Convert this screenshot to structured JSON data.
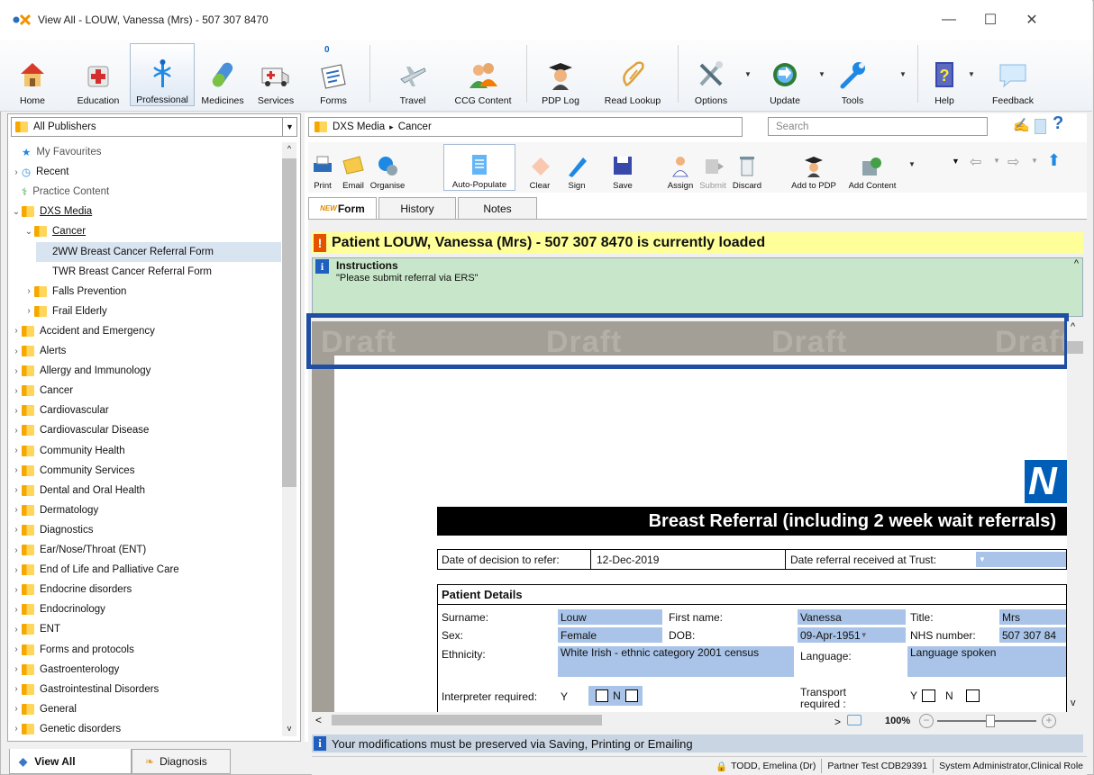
{
  "window": {
    "title": "View All  -  LOUW, Vanessa (Mrs) - 507 307 8470",
    "minimize": "—",
    "maximize": "☐",
    "close": "✕"
  },
  "ribbon": [
    {
      "label": "Home",
      "icon": "home-icon"
    },
    {
      "label": "Education",
      "icon": "education-icon"
    },
    {
      "label": "Professional",
      "icon": "professional-icon",
      "selected": true
    },
    {
      "label": "Medicines",
      "icon": "medicines-icon"
    },
    {
      "label": "Services",
      "icon": "ambulance-icon"
    },
    {
      "label": "Forms",
      "icon": "forms-icon",
      "badge": "0"
    },
    {
      "label": "Travel",
      "icon": "plane-icon"
    },
    {
      "label": "CCG Content",
      "icon": "ccg-content-icon"
    },
    {
      "label": "PDP Log",
      "icon": "graduate-icon"
    },
    {
      "label": "Read Lookup",
      "icon": "read-lookup-icon"
    },
    {
      "label": "Options",
      "icon": "options-icon"
    },
    {
      "label": "Update",
      "icon": "update-icon"
    },
    {
      "label": "Tools",
      "icon": "wrench-icon"
    },
    {
      "label": "Help",
      "icon": "help-icon"
    },
    {
      "label": "Feedback",
      "icon": "feedback-icon"
    }
  ],
  "publisher": "All Publishers",
  "tree": [
    {
      "label": "My Favourites",
      "indent": 0,
      "type": "fav"
    },
    {
      "label": "Recent",
      "indent": 0,
      "type": "recent",
      "arrow": ">"
    },
    {
      "label": "Practice Content",
      "indent": 0,
      "type": "practice"
    },
    {
      "label": "DXS Media",
      "indent": 0,
      "type": "dxs",
      "arrow": "v",
      "underline": true
    },
    {
      "label": "Cancer",
      "indent": 1,
      "type": "folder",
      "arrow": "v",
      "underline": true
    },
    {
      "label": "2WW Breast Cancer Referral Form",
      "indent": 2,
      "type": "item",
      "selected": true
    },
    {
      "label": "TWR Breast Cancer Referral Form",
      "indent": 2,
      "type": "item"
    },
    {
      "label": "Falls Prevention",
      "indent": 1,
      "type": "folder",
      "arrow": ">"
    },
    {
      "label": "Frail Elderly",
      "indent": 1,
      "type": "folder",
      "arrow": ">"
    },
    {
      "label": "Accident and Emergency",
      "indent": 0,
      "type": "folder",
      "arrow": ">"
    },
    {
      "label": "Alerts",
      "indent": 0,
      "type": "folder",
      "arrow": ">"
    },
    {
      "label": "Allergy and Immunology",
      "indent": 0,
      "type": "folder",
      "arrow": ">"
    },
    {
      "label": "Cancer",
      "indent": 0,
      "type": "folder",
      "arrow": ">"
    },
    {
      "label": "Cardiovascular",
      "indent": 0,
      "type": "folder",
      "arrow": ">"
    },
    {
      "label": "Cardiovascular Disease",
      "indent": 0,
      "type": "folder",
      "arrow": ">"
    },
    {
      "label": "Community Health",
      "indent": 0,
      "type": "folder",
      "arrow": ">"
    },
    {
      "label": "Community Services",
      "indent": 0,
      "type": "folder",
      "arrow": ">"
    },
    {
      "label": "Dental and Oral Health",
      "indent": 0,
      "type": "folder",
      "arrow": ">"
    },
    {
      "label": "Dermatology",
      "indent": 0,
      "type": "folder",
      "arrow": ">"
    },
    {
      "label": "Diagnostics",
      "indent": 0,
      "type": "folder",
      "arrow": ">"
    },
    {
      "label": "Ear/Nose/Throat (ENT)",
      "indent": 0,
      "type": "folder",
      "arrow": ">"
    },
    {
      "label": "End of Life and Palliative Care",
      "indent": 0,
      "type": "folder",
      "arrow": ">"
    },
    {
      "label": "Endocrine disorders",
      "indent": 0,
      "type": "folder",
      "arrow": ">"
    },
    {
      "label": "Endocrinology",
      "indent": 0,
      "type": "folder",
      "arrow": ">"
    },
    {
      "label": "ENT",
      "indent": 0,
      "type": "folder",
      "arrow": ">"
    },
    {
      "label": "Forms and protocols",
      "indent": 0,
      "type": "folder",
      "arrow": ">"
    },
    {
      "label": "Gastroenterology",
      "indent": 0,
      "type": "folder",
      "arrow": ">"
    },
    {
      "label": "Gastrointestinal Disorders",
      "indent": 0,
      "type": "folder",
      "arrow": ">"
    },
    {
      "label": "General",
      "indent": 0,
      "type": "folder",
      "arrow": ">"
    },
    {
      "label": "Genetic disorders",
      "indent": 0,
      "type": "folder",
      "arrow": ">"
    }
  ],
  "left_tabs": {
    "view_all": "View All",
    "diagnosis": "Diagnosis"
  },
  "breadcrumb": {
    "root": "DXS Media",
    "sep": "▸",
    "leaf": "Cancer"
  },
  "search_placeholder": "Search",
  "toolbar": [
    "Print",
    "Email",
    "Organise",
    "Auto-Populate",
    "Clear",
    "Sign",
    "Save",
    "Assign",
    "Submit",
    "Discard",
    "Add to PDP",
    "Add Content"
  ],
  "form_tabs": {
    "new_badge": "NEW",
    "form": "Form",
    "history": "History",
    "notes": "Notes"
  },
  "patient_bar": "Patient LOUW, Vanessa (Mrs) - 507 307 8470 is currently loaded",
  "instructions": {
    "title": "Instructions",
    "text": "\"Please submit referral via ERS\""
  },
  "watermark": "Draft",
  "logo_text": "N",
  "form": {
    "heading": "Breast Referral (including 2 week wait referrals)",
    "decision_label": "Date of decision to refer:",
    "decision_value": "12-Dec-2019",
    "received_label": "Date referral received at Trust:",
    "patient_details": "Patient Details",
    "surname_label": "Surname:",
    "surname": "Louw",
    "first_label": "First name:",
    "first": "Vanessa",
    "title_label": "Title:",
    "title": "Mrs",
    "sex_label": "Sex:",
    "sex": "Female",
    "dob_label": "DOB:",
    "dob": "09-Apr-1951",
    "nhs_label": "NHS number:",
    "nhs": "507 307 84",
    "ethnicity_label": "Ethnicity:",
    "ethnicity": "White Irish - ethnic category 2001 census",
    "language_label": "Language:",
    "language": "Language spoken",
    "interpreter_label": "Interpreter required:",
    "y": "Y",
    "n": "N",
    "transport_label": "Transport required :"
  },
  "zoom": "100%",
  "status_message": "Your modifications must be preserved via Saving, Printing or Emailing",
  "status_user": "TODD, Emelina (Dr)",
  "status_practice": "Partner Test CDB29391",
  "status_role": "System Administrator,Clinical Role"
}
